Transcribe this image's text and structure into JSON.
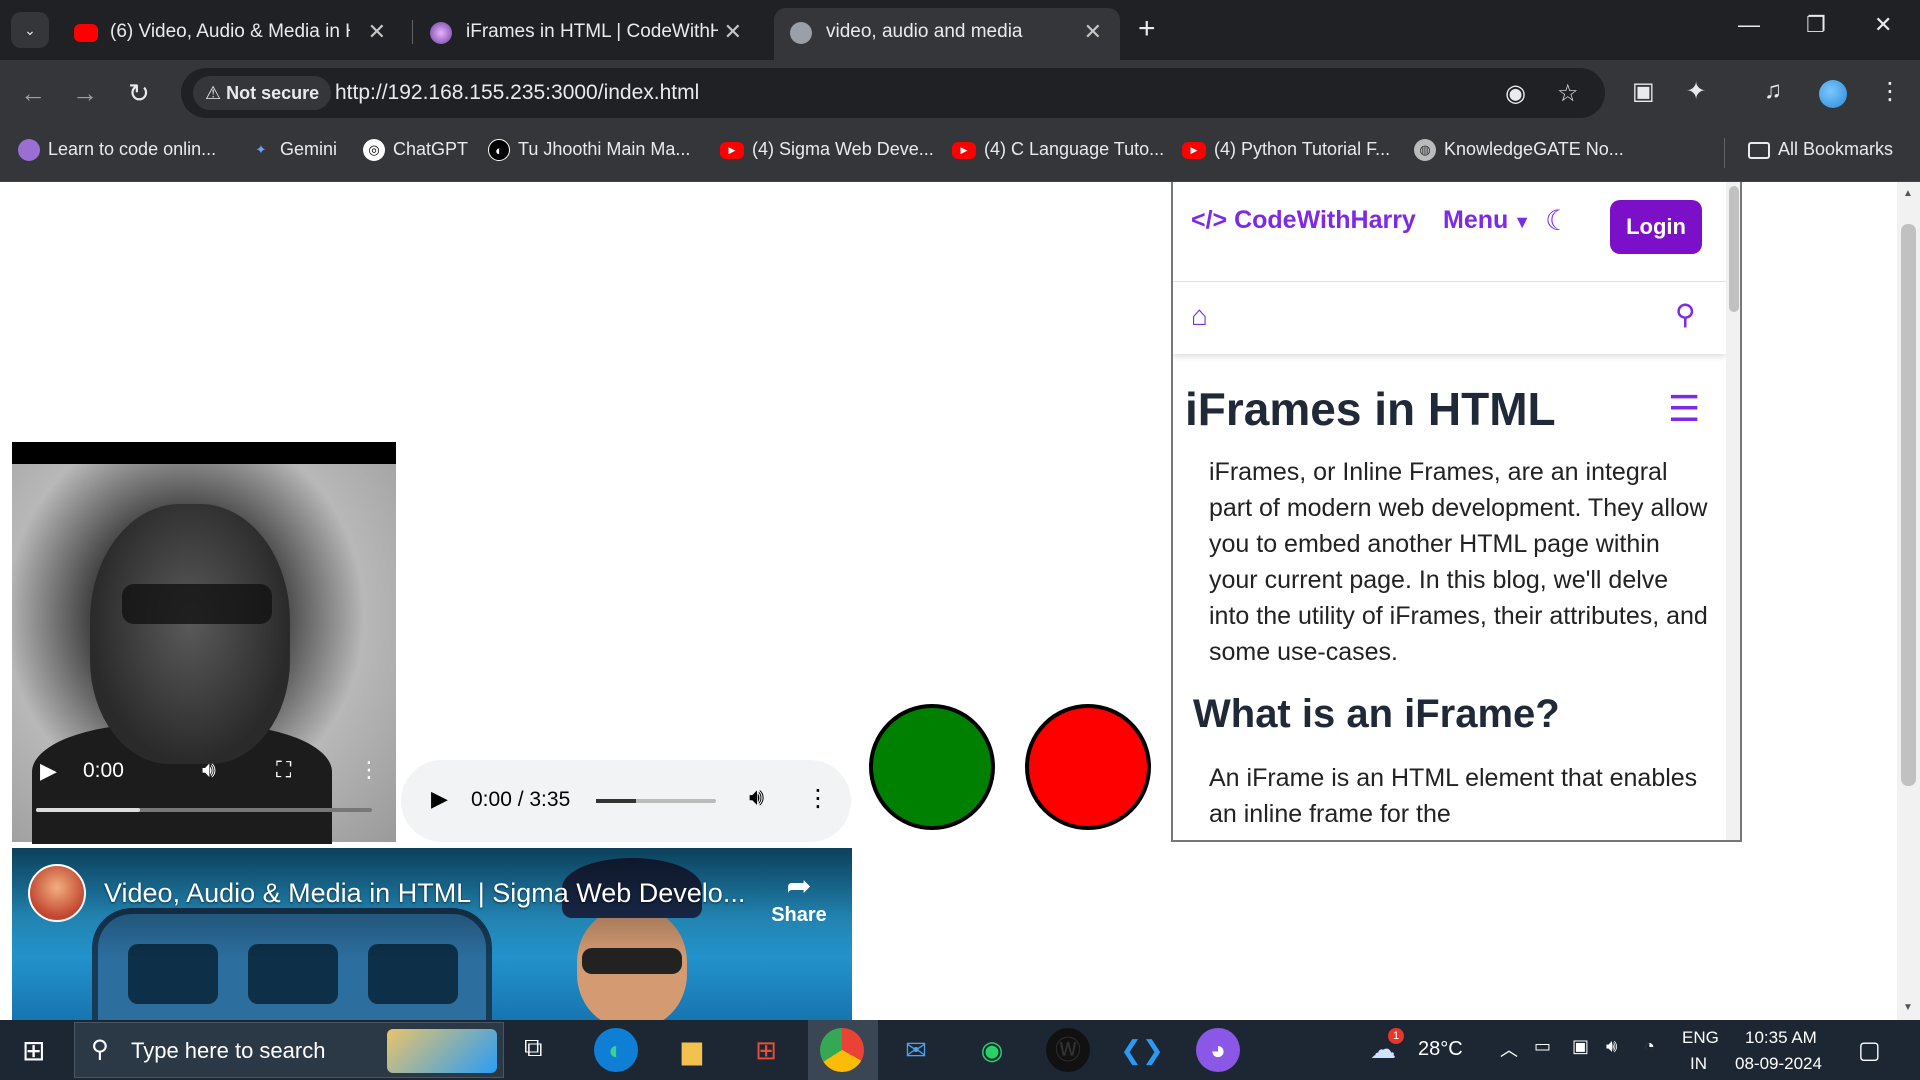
{
  "tabs": [
    {
      "title": "(6) Video, Audio & Media in HT",
      "active": false
    },
    {
      "title": "iFrames in HTML | CodeWithHa",
      "active": false
    },
    {
      "title": "video, audio and media",
      "active": true
    }
  ],
  "omnibox": {
    "security": "Not secure",
    "url": "http://192.168.155.235:3000/index.html"
  },
  "bookmarks": [
    "Learn to code onlin...",
    "Gemini",
    "ChatGPT",
    "Tu Jhoothi Main Ma...",
    "(4) Sigma Web Deve...",
    "(4) C Language Tuto...",
    "(4) Python Tutorial F...",
    "KnowledgeGATE No...",
    "All Bookmarks"
  ],
  "video": {
    "time": "0:00",
    "progress": 0.31
  },
  "audio": {
    "time": "0:00 / 3:35",
    "volume": 0.33
  },
  "circles": {
    "green": "#008000",
    "red": "#ff0000"
  },
  "youtube": {
    "title": "Video, Audio & Media in HTML | Sigma Web Develo...",
    "share": "Share"
  },
  "cwh": {
    "logo": "</> CodeWithHarry",
    "menu": "Menu",
    "login": "Login",
    "h1": "iFrames in HTML",
    "p1": "iFrames, or Inline Frames, are an integral part of modern web development. They allow you to embed another HTML page within your current page. In this blog, we'll delve into the utility of iFrames, their attributes, and some use-cases.",
    "h2": "What is an iFrame?",
    "p2": "An iFrame is an HTML element that enables an inline frame for the",
    "accent": "#7c2ae8"
  },
  "taskbar": {
    "search_placeholder": "Type here to search",
    "weather": "28°C",
    "weather_badge": "1",
    "lang_top": "ENG",
    "lang_bottom": "IN",
    "time": "10:35 AM",
    "date": "08-09-2024"
  }
}
